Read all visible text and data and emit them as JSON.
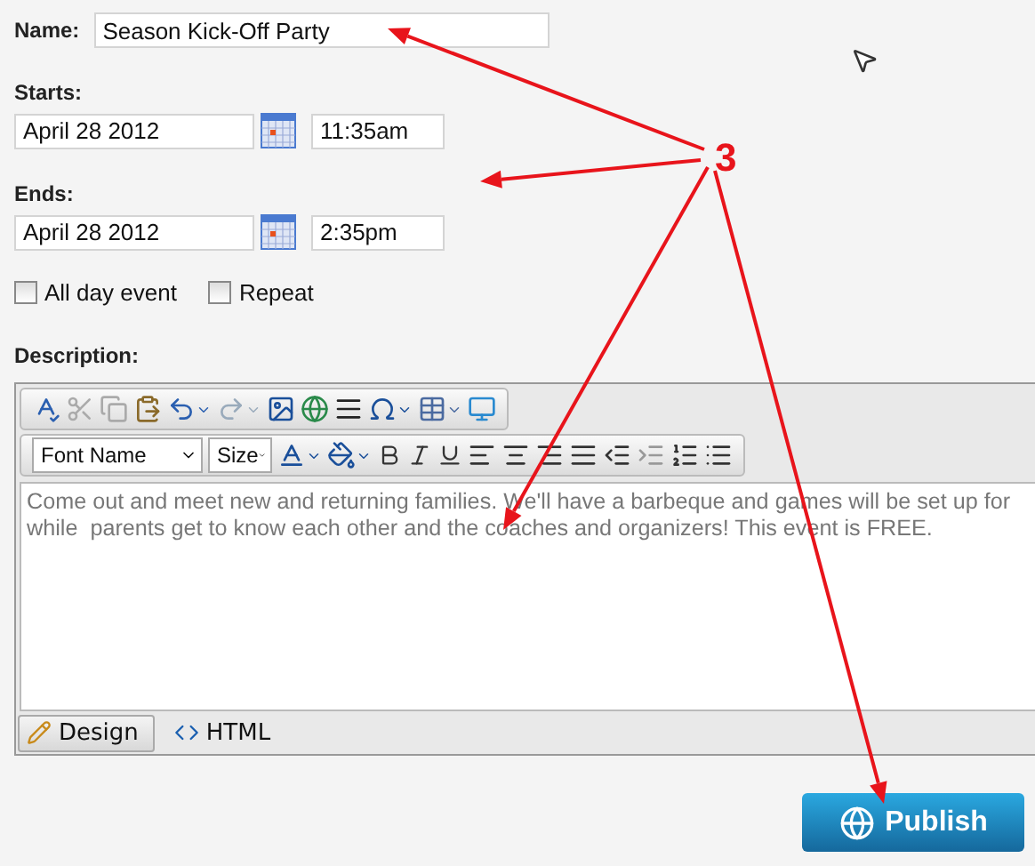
{
  "name": {
    "label": "Name:",
    "value": "Season Kick-Off Party"
  },
  "starts": {
    "label": "Starts:",
    "date": "April 28 2012",
    "time": "11:35am"
  },
  "ends": {
    "label": "Ends:",
    "date": "April 28 2012",
    "time": "2:35pm"
  },
  "options": [
    {
      "label": "All day event",
      "checked": false
    },
    {
      "label": "Repeat",
      "checked": false
    }
  ],
  "description": {
    "label": "Description:",
    "font_name": "Font Name",
    "size": "Size",
    "lines": [
      "Come out and meet new and returning families. We'll have a barbeque and games will be set up for",
      "while  parents get to know each other and the coaches and organizers! This event is FREE."
    ],
    "modes": [
      {
        "label": "Design",
        "kind": "design",
        "selected": true
      },
      {
        "label": "HTML",
        "kind": "html",
        "selected": false
      }
    ]
  },
  "publish_button": "Publish",
  "annotation": {
    "label": "3"
  }
}
